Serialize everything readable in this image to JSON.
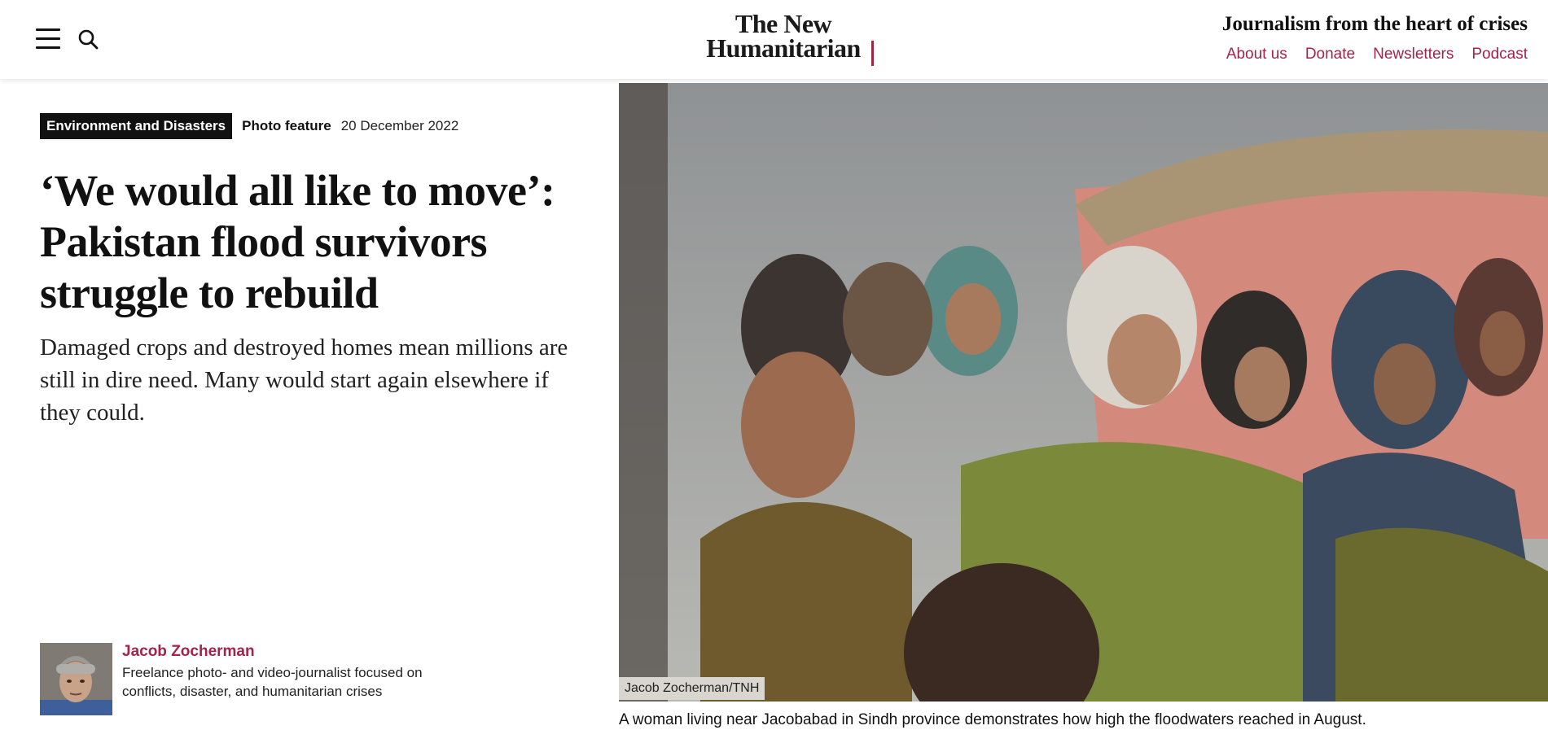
{
  "header": {
    "logo_line1": "The New",
    "logo_line2": "Humanitarian",
    "tagline": "Journalism from the heart of crises",
    "nav": [
      "About us",
      "Donate",
      "Newsletters",
      "Podcast"
    ],
    "accent_color": "#a2244b"
  },
  "article": {
    "category": "Environment and Disasters",
    "type": "Photo feature",
    "date": "20 December 2022",
    "headline": "‘We would all like to move’: Pakistan flood survivors struggle to rebuild",
    "standfirst": "Damaged crops and destroyed homes mean millions are still in dire need. Many would start again elsewhere if they could."
  },
  "author": {
    "name": "Jacob Zocherman",
    "bio": "Freelance photo- and video-journalist focused on conflicts, disaster, and humanitarian crises"
  },
  "photo": {
    "credit": "Jacob Zocherman/TNH",
    "caption": "A woman living near Jacobabad in Sindh province demonstrates how high the floodwaters reached in August."
  },
  "icons": [
    "menu-icon",
    "search-icon"
  ]
}
